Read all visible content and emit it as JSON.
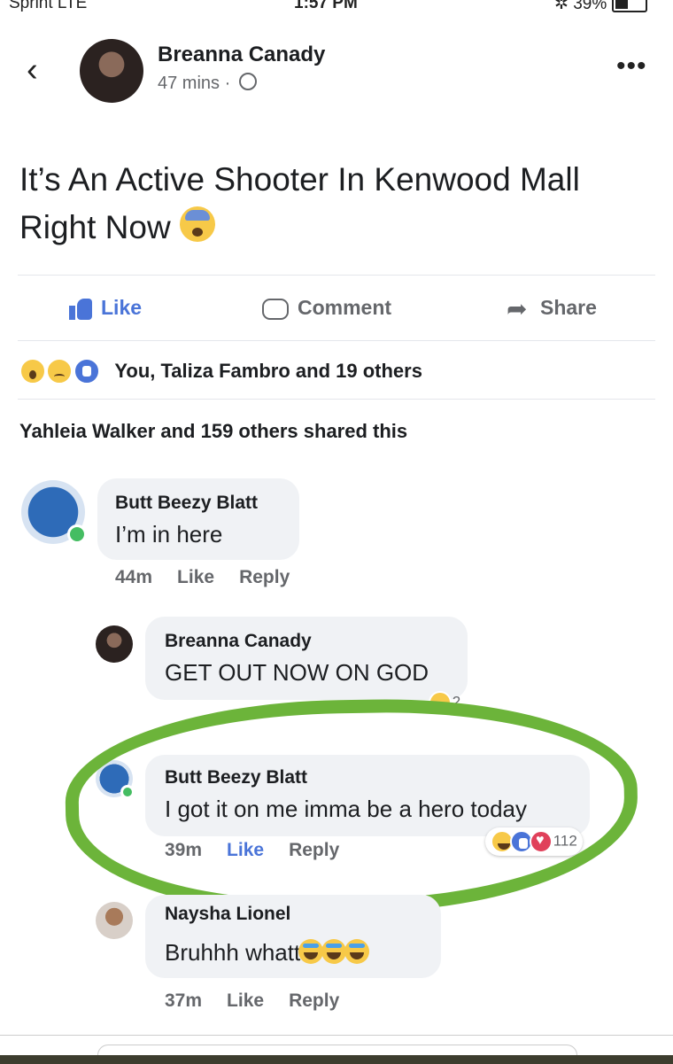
{
  "status_bar": {
    "carrier": "Sprint LTE",
    "time": "1:57 PM",
    "battery": "✲ 39%"
  },
  "post": {
    "author": "Breanna Canady",
    "time": "47 mins",
    "separator": "·",
    "text": "It’s An Active Shooter In Kenwood Mall Right Now",
    "emoji": "fearful-face"
  },
  "actions": {
    "like": "Like",
    "comment": "Comment",
    "share": "Share"
  },
  "reactions": {
    "icons": [
      "wow",
      "sad",
      "like"
    ],
    "summary": "You, Taliza Fambro and 19 others"
  },
  "shares": {
    "text": "Yahleia Walker and 159 others shared this"
  },
  "comments": [
    {
      "author": "Butt Beezy Blatt",
      "text": "I’m in here",
      "time": "44m",
      "like": "Like",
      "reply": "Reply"
    },
    {
      "author": "Breanna Canady",
      "text": "GET OUT NOW ON GOD",
      "reaction_count": "2"
    },
    {
      "author": "Butt Beezy Blatt",
      "text": "I got it on me imma be a hero today",
      "time": "39m",
      "like": "Like",
      "reply": "Reply",
      "reaction_count": "112",
      "highlight_color": "#6cb43a"
    },
    {
      "author": "Naysha Lionel",
      "text": "Bruhhh whatt",
      "time": "37m",
      "like": "Like",
      "reply": "Reply",
      "emojis": [
        "tears-of-joy",
        "tears-of-joy",
        "tears-of-joy"
      ]
    }
  ],
  "colors": {
    "like_blue": "#4a74d8",
    "secondary_text": "#65676b",
    "bubble_bg": "#f0f2f5",
    "online_green": "#45bd62"
  }
}
